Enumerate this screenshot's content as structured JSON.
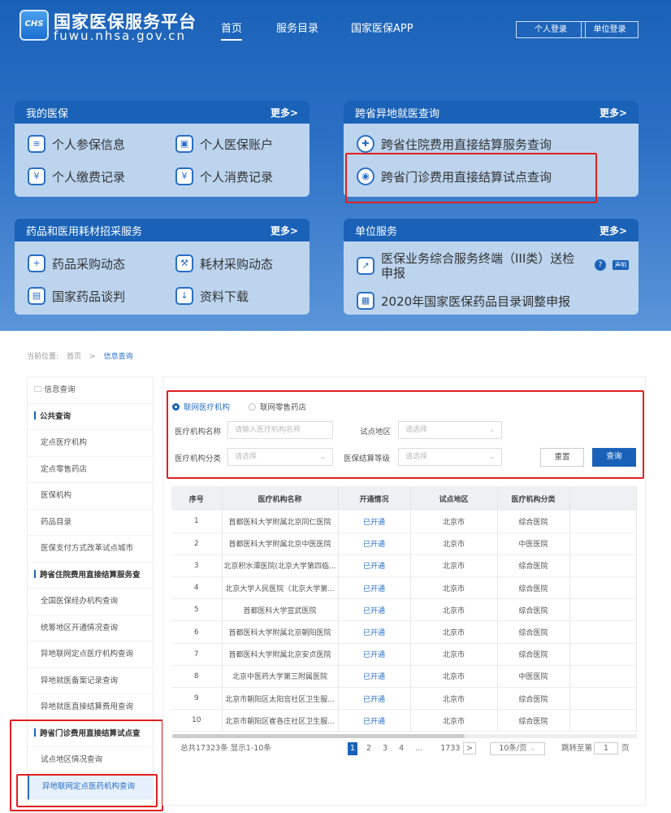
{
  "header": {
    "logo_text": "CHS",
    "title": "国家医保服务平台",
    "url": "fuwu.nhsa.gov.cn",
    "nav": [
      "首页",
      "服务目录",
      "国家医保APP"
    ],
    "login_personal": "个人登录",
    "login_unit": "单位登录"
  },
  "cards": [
    {
      "title": "我的医保",
      "more": "更多>",
      "items": [
        "个人参保信息",
        "个人医保账户",
        "个人缴费记录",
        "个人消费记录"
      ]
    },
    {
      "title": "跨省异地就医查询",
      "more": "更多>",
      "items": [
        "跨省住院费用直接结算服务查询",
        "跨省门诊费用直接结算试点查询"
      ]
    },
    {
      "title": "药品和医用耗材招采服务",
      "more": "更多>",
      "items": [
        "药品采购动态",
        "耗材采购动态",
        "国家药品谈判",
        "资料下载"
      ]
    },
    {
      "title": "单位服务",
      "more": "更多>",
      "items": [
        "医保业务综合服务终端（III类）送检申报",
        "2020年国家医保药品目录调整申报"
      ],
      "help": "?",
      "badge": "声明"
    }
  ],
  "breadcrumb": {
    "label": "当前位置:",
    "home": "首页",
    "sep": ">",
    "current": "信息查询"
  },
  "sidebar": {
    "root": "信息查询",
    "groups": [
      {
        "title": "公共查询",
        "items": [
          "定点医疗机构",
          "定点零售药店",
          "医保机构",
          "药品目录",
          "医保支付方式改革试点城市"
        ]
      },
      {
        "title": "跨省住院费用直接结算服务查",
        "items": [
          "全国医保经办机构查询",
          "统筹地区开通情况查询",
          "异地联网定点医疗机构查询",
          "异地就医备案记录查询",
          "异地就医直接结算费用查询"
        ]
      },
      {
        "title": "跨省门诊费用直接结算试点查",
        "items": [
          "试点地区情况查询",
          "异地联网定点医药机构查询"
        ]
      }
    ],
    "active": "异地联网定点医药机构查询"
  },
  "filter": {
    "radio_options": [
      "联网医疗机构",
      "联网零售药店"
    ],
    "selected": "联网医疗机构",
    "name_label": "医疗机构名称",
    "name_placeholder": "请输入医疗机构名称",
    "area_label": "试点地区",
    "area_placeholder": "请选择",
    "type_label": "医疗机构分类",
    "type_placeholder": "请选择",
    "level_label": "医保结算等级",
    "level_placeholder": "请选择",
    "reset": "重置",
    "search": "查询"
  },
  "table": {
    "columns": [
      "序号",
      "医疗机构名称",
      "开通情况",
      "试点地区",
      "医疗机构分类"
    ],
    "rows": [
      [
        "1",
        "首都医科大学附属北京同仁医院",
        "已开通",
        "北京市",
        "综合医院"
      ],
      [
        "2",
        "首都医科大学附属北京中医医院",
        "已开通",
        "北京市",
        "中医医院"
      ],
      [
        "3",
        "北京积水潭医院(北京大学第四临...",
        "已开通",
        "北京市",
        "综合医院"
      ],
      [
        "4",
        "北京大学人民医院（北京大学第...",
        "已开通",
        "北京市",
        "综合医院"
      ],
      [
        "5",
        "首都医科大学宣武医院",
        "已开通",
        "北京市",
        "综合医院"
      ],
      [
        "6",
        "首都医科大学附属北京朝阳医院",
        "已开通",
        "北京市",
        "综合医院"
      ],
      [
        "7",
        "首都医科大学附属北京安贞医院",
        "已开通",
        "北京市",
        "综合医院"
      ],
      [
        "8",
        "北京中医药大学第三附属医院",
        "已开通",
        "北京市",
        "中医医院"
      ],
      [
        "9",
        "北京市朝阳区太阳宫社区卫生服...",
        "已开通",
        "北京市",
        "综合医院"
      ],
      [
        "10",
        "北京市朝阳区崔各庄社区卫生服...",
        "已开通",
        "北京市",
        "综合医院"
      ]
    ]
  },
  "pagination": {
    "total": "总共17323条",
    "showing": "显示1-10条",
    "pages": [
      "1",
      "2",
      "3",
      "4",
      "...",
      "1733"
    ],
    "current": "1",
    "next": ">",
    "page_size": "10条/页",
    "jump_label": "跳转至第",
    "jump_value": "1",
    "page_unit": "页"
  },
  "colors": {
    "brand": "#1a62b8",
    "highlight": "#e02020"
  }
}
